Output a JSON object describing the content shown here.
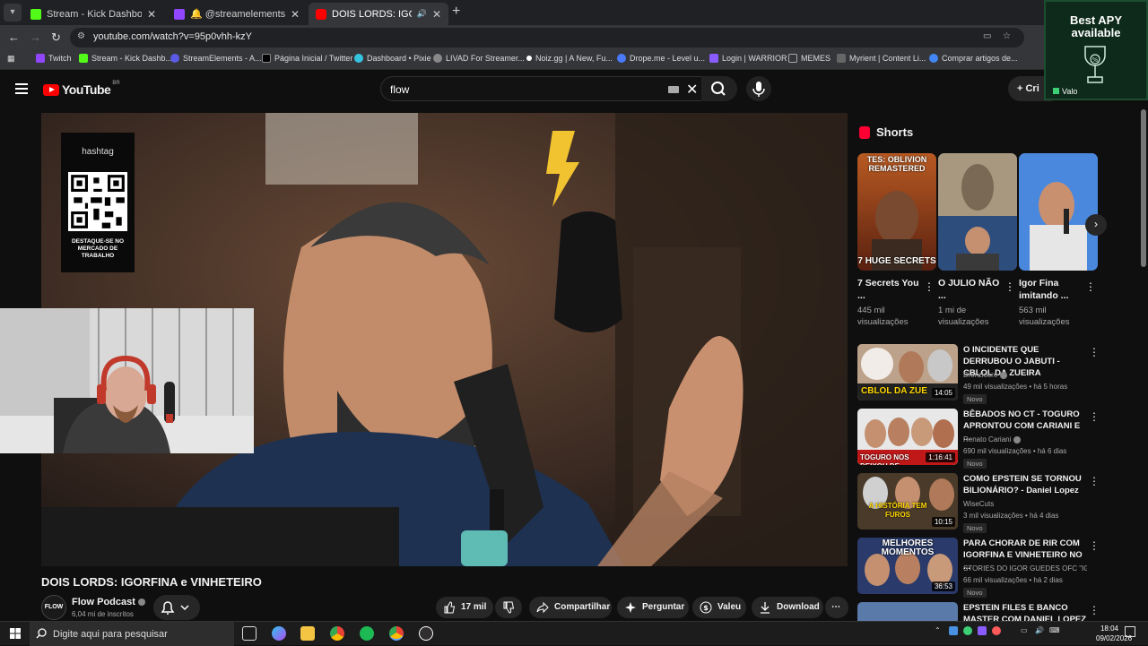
{
  "browser": {
    "tabs": [
      {
        "title": "Stream - Kick Dashboard",
        "active": false,
        "favicon_color": "#53fc18"
      },
      {
        "title": "🔔 @streamelements mentioned",
        "active": false,
        "favicon_color": "#9146ff"
      },
      {
        "title": "DOIS LORDS: IGORFINA e V",
        "active": true,
        "favicon_color": "#ff0000"
      }
    ],
    "url": "youtube.com/watch?v=95p0vhh-kzY",
    "bookmarks": [
      {
        "label": "Twitch",
        "color": "#9146ff"
      },
      {
        "label": "Stream - Kick Dashb...",
        "color": "#53fc18"
      },
      {
        "label": "StreamElements - A...",
        "color": "#5a5ae6"
      },
      {
        "label": "Página Inicial / Twitter",
        "color": "#000000"
      },
      {
        "label": "Dashboard • Pixie",
        "color": "#35c4e0"
      },
      {
        "label": "LIVAD For Streamer...",
        "color": "#888888"
      },
      {
        "label": "Noiz.gg | A New, Fu...",
        "color": "#ffffff"
      },
      {
        "label": "Drope.me - Level u...",
        "color": "#4a7bff"
      },
      {
        "label": "Login | WARRIOR",
        "color": "#8a5cff"
      },
      {
        "label": "MEMES",
        "color": "#aaaaaa"
      },
      {
        "label": "Myrient | Content Li...",
        "color": "#666666"
      },
      {
        "label": "Comprar artigos de...",
        "color": "#4285f4"
      }
    ]
  },
  "ad": {
    "title_line1": "Best APY",
    "title_line2": "available",
    "brand": "Valo",
    "trophy_text": "%"
  },
  "youtube": {
    "logo": "YouTube",
    "country": "BR",
    "search_query": "flow",
    "create_label": "Cri",
    "video": {
      "qr_brand": "hashtag",
      "qr_caption": "DESTAQUE-SE NO MERCADO DE TRABALHO",
      "title": "DOIS LORDS: IGORFINA e VINHETEIRO",
      "channel": "Flow Podcast",
      "channel_avatar_text": "FLOW",
      "subscribers": "6,04 mi de inscritos",
      "likes": "17 mil",
      "actions": [
        "Compartilhar",
        "Perguntar",
        "Valeu",
        "Download"
      ]
    },
    "shorts": {
      "header": "Shorts",
      "items": [
        {
          "title": "7 Secrets You ...",
          "views": "445 mil visualizações",
          "thumb_top": "TES: OBLIVION REMASTERED",
          "thumb_bottom": "7 HUGE SECRETS"
        },
        {
          "title": "O JULIO NÃO ...",
          "views": "1 mi de visualizações",
          "thumb_top": "",
          "thumb_bottom": ""
        },
        {
          "title": "Igor Fina imitando ...",
          "views": "563 mil visualizações",
          "thumb_top": "",
          "thumb_bottom": ""
        }
      ]
    },
    "recommendations": [
      {
        "title": "O INCIDENTE QUE DERRUBOU O JABUTI - CBLOL DA ZUEIRA",
        "channel": "Bronziocre",
        "verified": true,
        "views": "49 mil visualizações • há 5 horas",
        "badge": "Novo",
        "duration": "14:05",
        "thumb_caption": "CBLOL DA ZUE"
      },
      {
        "title": "BÊBADOS NO CT - TOGURO APRONTOU COM CARIANI E ...",
        "channel": "Renato Cariani",
        "verified": true,
        "views": "690 mil visualizações • há 6 dias",
        "badge": "Novo",
        "duration": "1:16:41",
        "thumb_caption": "TOGURO NOS DEIXOU DE"
      },
      {
        "title": "COMO EPSTEIN SE TORNOU BILIONÁRIO? - Daniel Lopez",
        "channel": "WiseCuts",
        "verified": false,
        "views": "3 mil visualizações • há 4 dias",
        "badge": "Novo",
        "duration": "10:15",
        "thumb_caption": "A HISTÓRIA TEM FUROS"
      },
      {
        "title": "PARA CHORAR DE RIR COM IGORFINA E VINHETEIRO NO ...",
        "channel": "STORIES DO IGOR GUEDES OFC \"IGORFI...",
        "verified": false,
        "views": "66 mil visualizações • há 2 dias",
        "badge": "Novo",
        "duration": "36:53",
        "thumb_caption": "MELHORES MOMENTOS"
      },
      {
        "title": "EPSTEIN FILES E BANCO MASTER COM DANIEL LOPEZ",
        "channel": "",
        "verified": false,
        "views": "",
        "badge": "",
        "duration": "",
        "thumb_caption": ""
      }
    ]
  },
  "taskbar": {
    "search_placeholder": "Digite aqui para pesquisar",
    "time": "18:04",
    "date": "09/02/2026"
  }
}
